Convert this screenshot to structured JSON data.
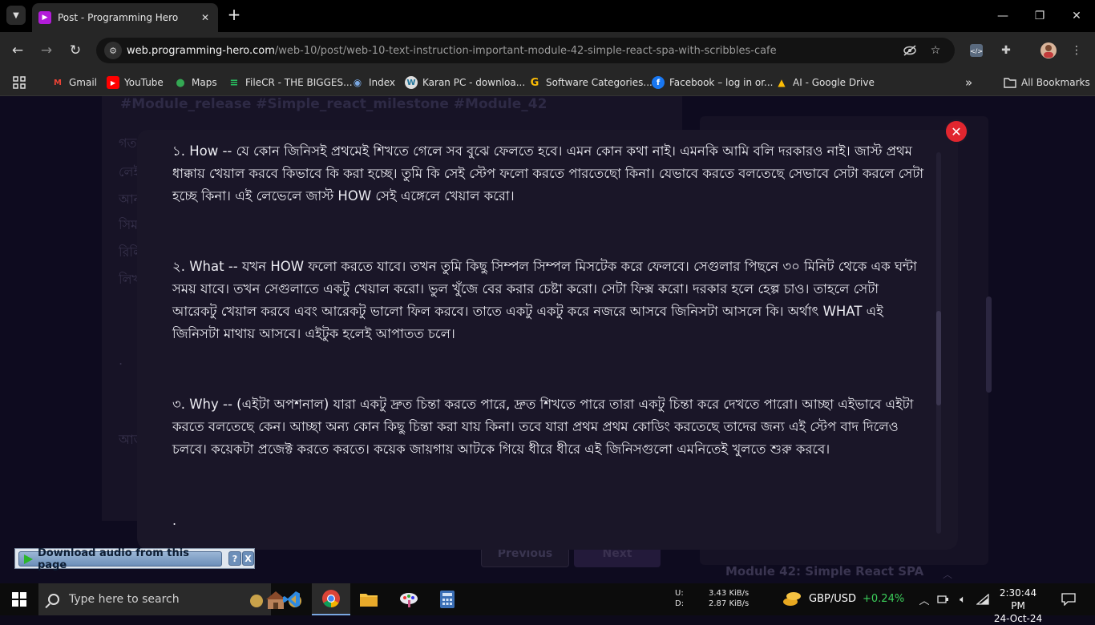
{
  "browser": {
    "tab_title": "Post - Programming Hero",
    "url_host": "web.programming-hero.com",
    "url_path": "/web-10/post/web-10-text-instruction-important-module-42-simple-react-spa-with-scribbles-cafe",
    "bookmarks": [
      {
        "label": "Gmail",
        "icon": "gmail-icon"
      },
      {
        "label": "YouTube",
        "icon": "youtube-icon"
      },
      {
        "label": "Maps",
        "icon": "maps-icon"
      },
      {
        "label": "FileCR - THE BIGGES...",
        "icon": "filecr-icon"
      },
      {
        "label": "Index",
        "icon": "index-icon"
      },
      {
        "label": "Karan PC - downloa...",
        "icon": "wordpress-icon"
      },
      {
        "label": "Software Categories...",
        "icon": "google-icon"
      },
      {
        "label": "Facebook – log in or...",
        "icon": "facebook-icon"
      },
      {
        "label": "AI - Google Drive",
        "icon": "drive-icon"
      }
    ],
    "all_bookmarks": "All Bookmarks",
    "more_bookmarks": "»"
  },
  "page": {
    "tags": "#Module_release #Simple_react_milestone #Module_42",
    "snippets": [
      "গত",
      "লেই",
      "আন",
      "সিম",
      "রিলি",
      "লিখ",
      ".",
      "আজ"
    ],
    "prev_label": "Previous",
    "next_label": "Next",
    "module_title": "Module 42: Simple React SPA"
  },
  "modal": {
    "paragraphs": [
      "১. How -- যে কোন জিনিসই প্রথমেই শিখতে গেলে সব বুঝে ফেলতে হবে। এমন কোন কথা নাই। এমনকি আমি বলি দরকারও নাই। জাস্ট প্রথম ধাক্কায় খেয়াল করবে কিভাবে কি করা হচ্ছে। তুমি কি সেই স্টেপ ফলো করতে পারতেছো কিনা। যেভাবে করতে বলতেছে সেভাবে সেটা করলে সেটা হচ্ছে কিনা। এই লেভেলে জাস্ট HOW সেই এঙ্গেলে খেয়াল করো।",
      "২. What -- যখন HOW ফলো করতে যাবে। তখন তুমি কিছু সিম্পল সিম্পল মিসটেক করে ফেলবে। সেগুলার পিছনে ৩০ মিনিট থেকে এক ঘন্টা সময় যাবে। তখন সেগুলাতে একটু খেয়াল করো। ভুল খুঁজে বের করার চেষ্টা করো। সেটা ফিক্স করো। দরকার হলে হেল্প চাও। তাহলে সেটা আরেকটু খেয়াল করবে এবং আরেকটু ভালো ফিল করবে। তাতে একটু একটু করে নজরে আসবে জিনিসটা আসলে কি। অর্থাৎ WHAT এই জিনিসটা মাথায় আসবে। এইটুক হলেই আপাতত চলে।",
      "৩. Why -- (এইটা অপশনাল) যারা একটু দ্রুত চিন্তা করতে পারে, দ্রুত শিখতে পারে তারা একটু চিন্তা করে দেখতে পারো। আচ্ছা এইভাবে এইটা করতে বলতেছে কেন। আচ্ছা অন্য কোন কিছু চিন্তা করা যায় কিনা। তবে যারা প্রথম প্রথম কোডিং করতেছে তাদের জন্য এই স্টেপ বাদ দিলেও চলবে। কয়েকটা প্রজেক্ট করতে করতে। কয়েক জায়গায় আটকে গিয়ে ধীরে ধীরে এই জিনিসগুলো এমনিতেই খুলতে শুরু করবে।"
    ],
    "trailing": ".",
    "close_icon": "close-icon"
  },
  "audio_widget": {
    "label": "Download audio from this page",
    "help": "?",
    "close": "X"
  },
  "taskbar": {
    "search_placeholder": "Type here to search",
    "net_up_label": "U:",
    "net_down_label": "D:",
    "net_up": "3.43 KiB/s",
    "net_down": "2.87 KiB/s",
    "fx_pair": "GBP/USD",
    "fx_change": "+0.24%",
    "time": "2:30:44 PM",
    "date": "24-Oct-24"
  },
  "colors": {
    "accent": "#e1262f",
    "fx_positive": "#3ccf5b",
    "brand": "#b21cd9"
  }
}
